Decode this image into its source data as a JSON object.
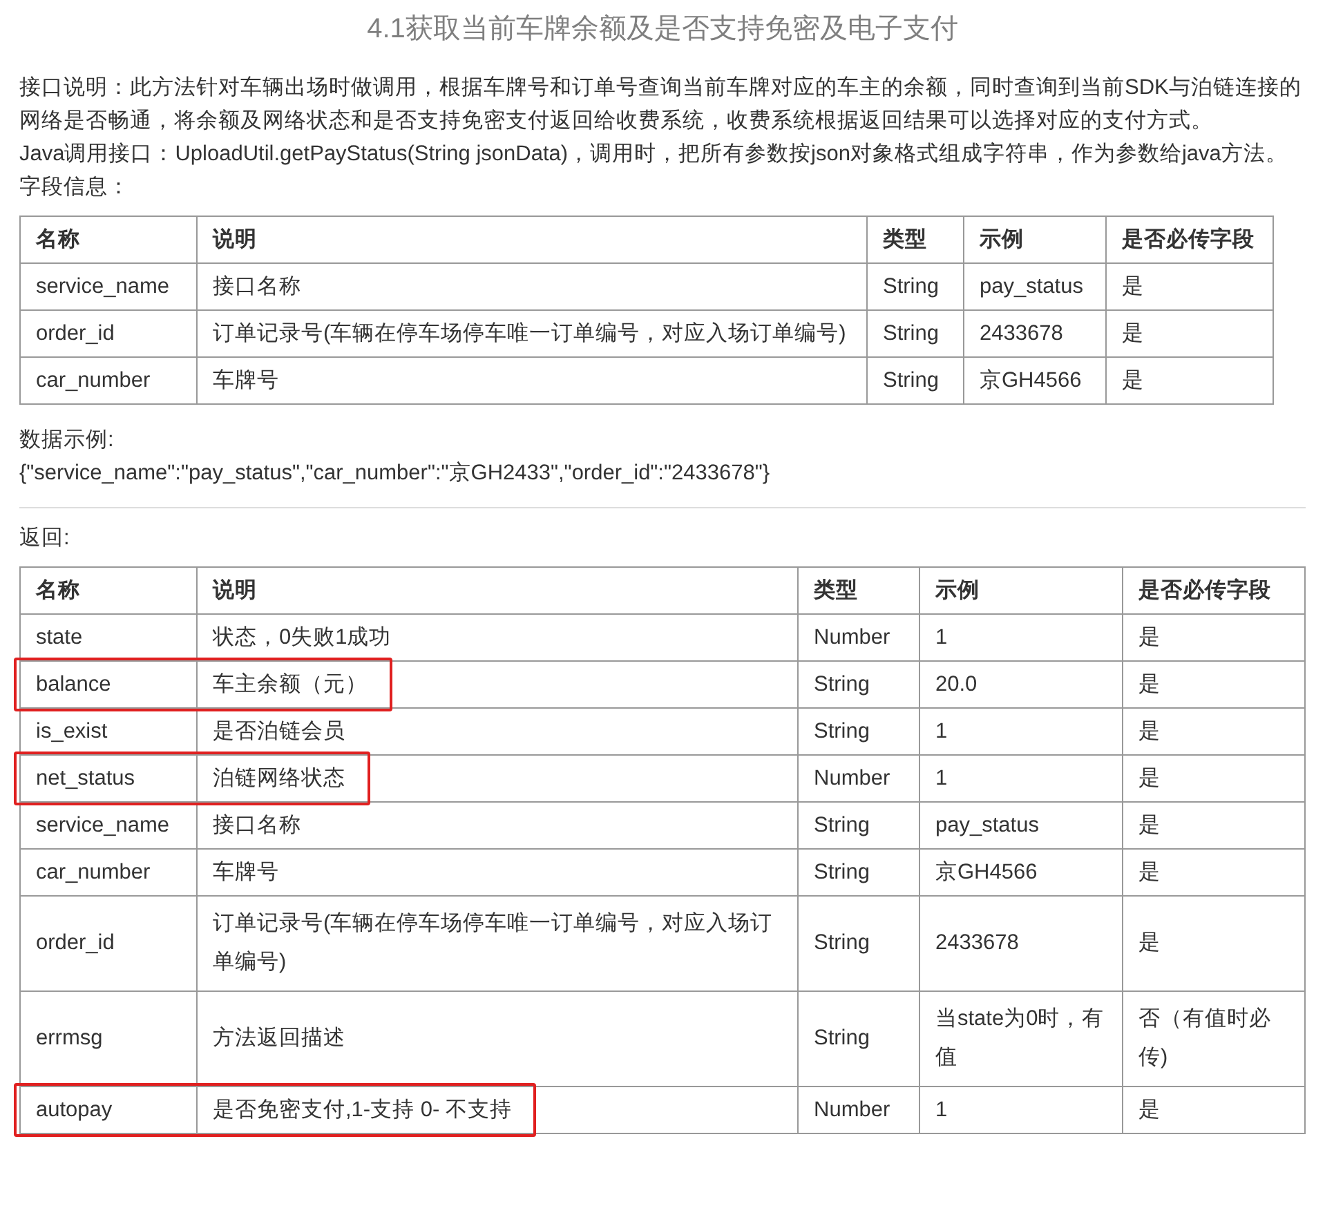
{
  "title": "4.1获取当前车牌余额及是否支持免密及电子支付",
  "paragraphs": [
    "接口说明：此方法针对车辆出场时做调用，根据车牌号和订单号查询当前车牌对应的车主的余额，同时查询到当前SDK与泊链连接的网络是否畅通，将余额及网络状态和是否支持免密支付返回给收费系统，收费系统根据返回结果可以选择对应的支付方式。",
    "Java调用接口：UploadUtil.getPayStatus(String jsonData)，调用时，把所有参数按json对象格式组成字符串，作为参数给java方法。",
    "字段信息："
  ],
  "request_table": {
    "columns": [
      "名称",
      "说明",
      "类型",
      "示例",
      "是否必传字段"
    ],
    "rows": [
      {
        "cells": [
          "service_name",
          "接口名称",
          "String",
          "pay_status",
          "是"
        ]
      },
      {
        "cells": [
          "order_id",
          "订单记录号(车辆在停车场停车唯一订单编号，对应入场订单编号)",
          "String",
          "2433678",
          "是"
        ]
      },
      {
        "cells": [
          "car_number",
          "车牌号",
          "String",
          "京GH4566",
          "是"
        ]
      }
    ]
  },
  "example_label": "数据示例:",
  "example": "{\"service_name\":\"pay_status\",\"car_number\":\"京GH2433\",\"order_id\":\"2433678\"}",
  "return_label": "返回:",
  "response_table": {
    "columns": [
      "名称",
      "说明",
      "类型",
      "示例",
      "是否必传字段"
    ],
    "rows": [
      {
        "cells": [
          "state",
          "状态，0失败1成功",
          "Number",
          "1",
          "是"
        ],
        "highlighted": false
      },
      {
        "cells": [
          "balance",
          "车主余额（元）",
          "String",
          "20.0",
          "是"
        ],
        "highlighted": true
      },
      {
        "cells": [
          "is_exist",
          "是否泊链会员",
          "String",
          "1",
          "是"
        ],
        "highlighted": false
      },
      {
        "cells": [
          "net_status",
          "泊链网络状态",
          "Number",
          "1",
          "是"
        ],
        "highlighted": true
      },
      {
        "cells": [
          "service_name",
          "接口名称",
          "String",
          "pay_status",
          "是"
        ],
        "highlighted": false
      },
      {
        "cells": [
          "car_number",
          "车牌号",
          "String",
          "京GH4566",
          "是"
        ],
        "highlighted": false
      },
      {
        "cells": [
          "order_id",
          "订单记录号(车辆在停车场停车唯一订单编号，对应入场订单编号)",
          "String",
          "2433678",
          "是"
        ],
        "highlighted": false
      },
      {
        "cells": [
          "errmsg",
          "方法返回描述",
          "String",
          "当state为0时，有值",
          "否（有值时必传)"
        ],
        "highlighted": false
      },
      {
        "cells": [
          "autopay",
          "是否免密支付,1-支持 0- 不支持",
          "Number",
          "1",
          "是"
        ],
        "highlighted": true
      }
    ]
  }
}
